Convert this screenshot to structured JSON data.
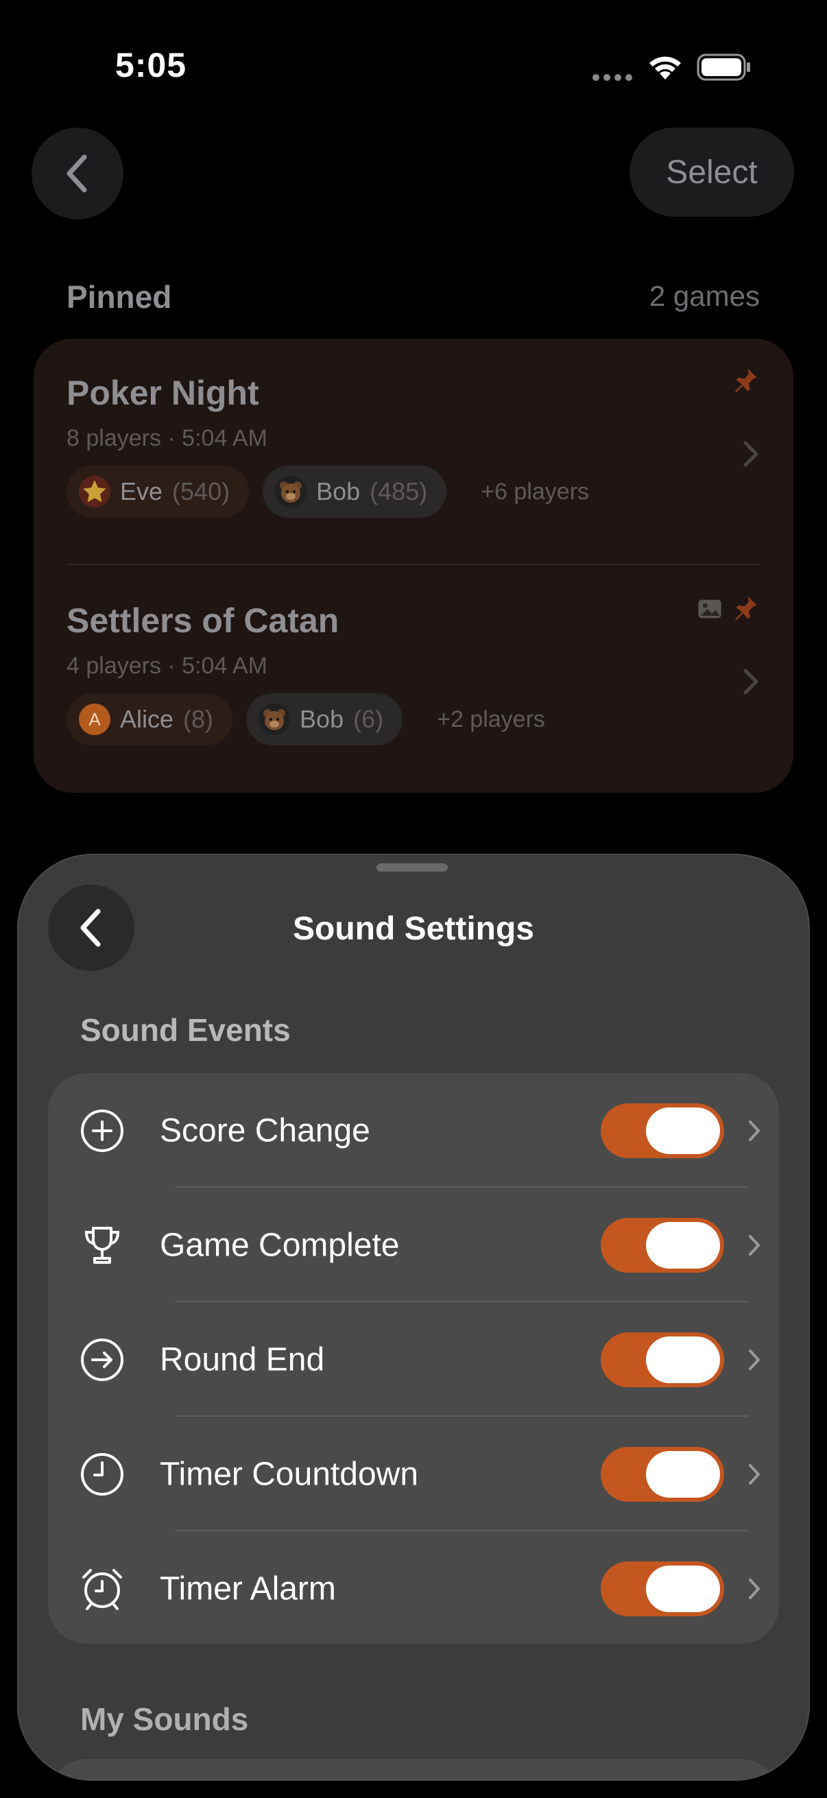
{
  "status": {
    "time": "5:05"
  },
  "nav": {
    "select_label": "Select"
  },
  "pinned": {
    "title": "Pinned",
    "count": "2 games",
    "games": [
      {
        "title": "Poker Night",
        "subtitle": "8 players · 5:04 AM",
        "players": [
          {
            "name": "Eve",
            "score": "(540)",
            "avatar": "star-icon"
          },
          {
            "name": "Bob",
            "score": "(485)",
            "avatar": "bear-emoji"
          }
        ],
        "more": "+6 players"
      },
      {
        "title": "Settlers of Catan",
        "subtitle": "4 players · 5:04 AM",
        "players": [
          {
            "name": "Alice",
            "score": "(8)",
            "avatar_letter": "A"
          },
          {
            "name": "Bob",
            "score": "(6)",
            "avatar": "bear-emoji"
          }
        ],
        "more": "+2 players"
      }
    ]
  },
  "sheet": {
    "title": "Sound Settings",
    "section_events": "Sound Events",
    "events": [
      {
        "label": "Score Change",
        "icon": "plus-circle-icon",
        "enabled": true
      },
      {
        "label": "Game Complete",
        "icon": "trophy-icon",
        "enabled": true
      },
      {
        "label": "Round End",
        "icon": "arrow-circle-icon",
        "enabled": true
      },
      {
        "label": "Timer Countdown",
        "icon": "clock-icon",
        "enabled": true
      },
      {
        "label": "Timer Alarm",
        "icon": "alarm-clock-icon",
        "enabled": true
      }
    ],
    "section_my_sounds": "My Sounds"
  },
  "colors": {
    "accent": "#c4561f",
    "sheet_bg": "#3c3c3c",
    "card_bg": "#4a4a4a"
  }
}
